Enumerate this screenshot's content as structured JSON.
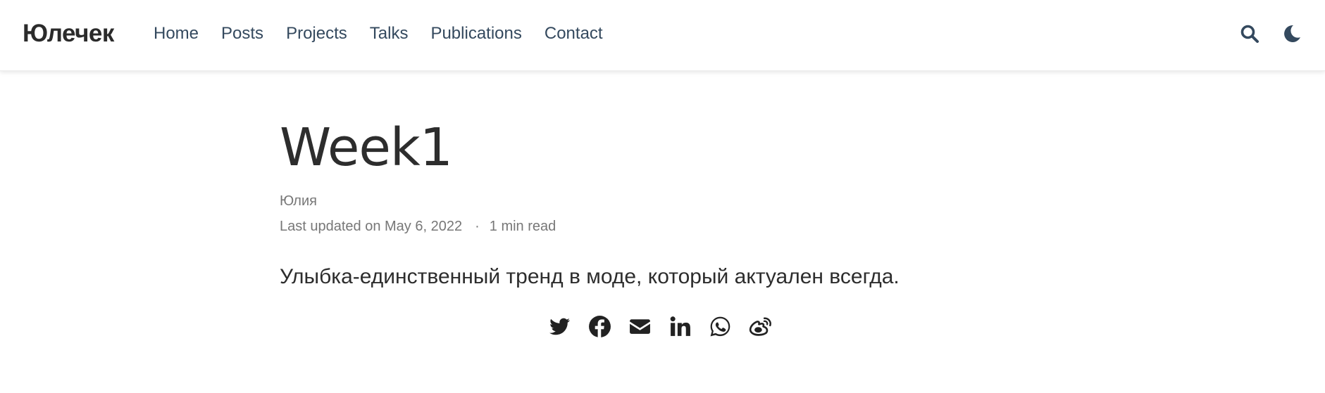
{
  "header": {
    "brand": "Юлечек",
    "nav": [
      "Home",
      "Posts",
      "Projects",
      "Talks",
      "Publications",
      "Contact"
    ],
    "icons": [
      "search-icon",
      "moon-icon"
    ]
  },
  "article": {
    "title": "Week1",
    "author": "Юлия",
    "last_updated": "Last updated on May 6, 2022",
    "separator": "·",
    "read_time": "1 min read",
    "summary": "Улыбка-единственный тренд в моде, который актуален всегда."
  },
  "share": {
    "icons": [
      "twitter-icon",
      "facebook-icon",
      "email-icon",
      "linkedin-icon",
      "whatsapp-icon",
      "weibo-icon"
    ]
  },
  "colors": {
    "nav_text": "#34495e",
    "brand_text": "#2b2b2b",
    "meta_text": "#777777",
    "icon_fill": "#222222"
  }
}
